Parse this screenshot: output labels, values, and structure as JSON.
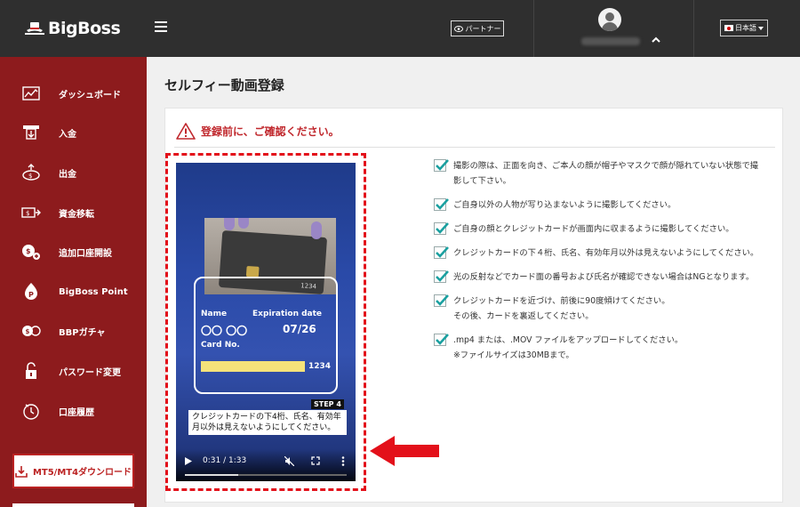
{
  "header": {
    "logo_text": "BigBoss",
    "partner_label": "パートナー",
    "language_label": "日本語"
  },
  "sidebar": {
    "items": [
      {
        "label": "ダッシュボード",
        "icon": "chart-icon"
      },
      {
        "label": "入金",
        "icon": "deposit-icon"
      },
      {
        "label": "出金",
        "icon": "withdraw-icon"
      },
      {
        "label": "資金移転",
        "icon": "transfer-icon"
      },
      {
        "label": "追加口座開設",
        "icon": "add-account-icon"
      },
      {
        "label": "BigBoss Point",
        "icon": "point-icon"
      },
      {
        "label": "BBPガチャ",
        "icon": "gacha-icon"
      },
      {
        "label": "パスワード変更",
        "icon": "lock-icon"
      },
      {
        "label": "口座履歴",
        "icon": "history-icon"
      }
    ],
    "download_label": "MT5/MT4ダウンロード"
  },
  "main": {
    "title": "セルフィー動画登録",
    "warning": "登録前に、ご確認ください。",
    "checklist": [
      {
        "lines": [
          "撮影の際は、正面を向き、ご本人の顔が帽子やマスクで顔が隠れていない状態で撮",
          "影して下さい。"
        ]
      },
      {
        "lines": [
          "ご自身以外の人物が写り込まないように撮影してください。"
        ]
      },
      {
        "lines": [
          "ご自身の顔とクレジットカードが画面内に収まるように撮影してください。"
        ]
      },
      {
        "lines": [
          "クレジットカードの下４桁、氏名、有効年月以外は見えないようにしてください。"
        ]
      },
      {
        "lines": [
          "光の反射などでカード面の番号および氏名が確認できない場合はNGとなります。"
        ]
      },
      {
        "lines": [
          "クレジットカードを近づけ、前後に90度傾けてください。",
          "その後、カードを裏返してください。"
        ]
      },
      {
        "lines": [
          ".mp4 または、.MOV ファイルをアップロードしてください。",
          "※ファイルサイズは30MBまで。"
        ]
      }
    ]
  },
  "video": {
    "card_number_photo": "1234",
    "name_label": "Name",
    "expiry_label": "Expiration date",
    "name_value": "〇〇 〇〇",
    "expiry_value": "07/26",
    "card_no_label": "Card No.",
    "card_last4": "1234",
    "step_label": "STEP 4",
    "caption": "クレジットカードの下4桁、氏名、有効年月以外は見えないようにしてください。",
    "time": "0:31 / 1:33",
    "progress": 0.33
  }
}
